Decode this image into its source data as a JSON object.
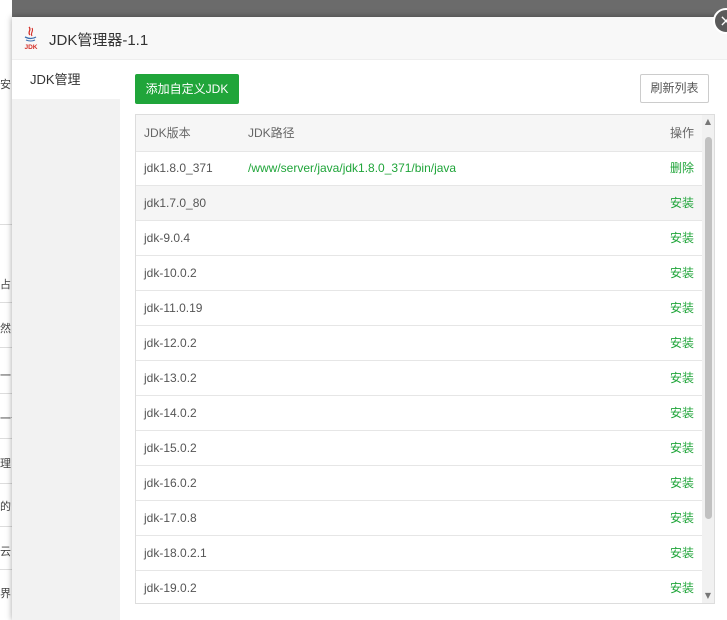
{
  "background_fragments": [
    "安",
    "占",
    "然",
    "一",
    "一个",
    "理",
    "的",
    "云",
    "界"
  ],
  "dialog": {
    "title": "JDK管理器-1.1",
    "logo_text": "JDK",
    "close_symbol": "×"
  },
  "sidebar": {
    "items": [
      {
        "label": "JDK管理"
      }
    ]
  },
  "toolbar": {
    "add_label": "添加自定义JDK",
    "refresh_label": "刷新列表"
  },
  "table": {
    "headers": {
      "version": "JDK版本",
      "path": "JDK路径",
      "action": "操作"
    },
    "rows": [
      {
        "version": "jdk1.8.0_371",
        "path": "/www/server/java/jdk1.8.0_371/bin/java",
        "action": "删除"
      },
      {
        "version": "jdk1.7.0_80",
        "path": "",
        "action": "安装"
      },
      {
        "version": "jdk-9.0.4",
        "path": "",
        "action": "安装"
      },
      {
        "version": "jdk-10.0.2",
        "path": "",
        "action": "安装"
      },
      {
        "version": "jdk-11.0.19",
        "path": "",
        "action": "安装"
      },
      {
        "version": "jdk-12.0.2",
        "path": "",
        "action": "安装"
      },
      {
        "version": "jdk-13.0.2",
        "path": "",
        "action": "安装"
      },
      {
        "version": "jdk-14.0.2",
        "path": "",
        "action": "安装"
      },
      {
        "version": "jdk-15.0.2",
        "path": "",
        "action": "安装"
      },
      {
        "version": "jdk-16.0.2",
        "path": "",
        "action": "安装"
      },
      {
        "version": "jdk-17.0.8",
        "path": "",
        "action": "安装"
      },
      {
        "version": "jdk-18.0.2.1",
        "path": "",
        "action": "安装"
      },
      {
        "version": "jdk-19.0.2",
        "path": "",
        "action": "安装"
      }
    ]
  },
  "colors": {
    "accent": "#20a53a",
    "header_bg": "#f6f6f6",
    "hover_row": "#f5f5f5"
  }
}
